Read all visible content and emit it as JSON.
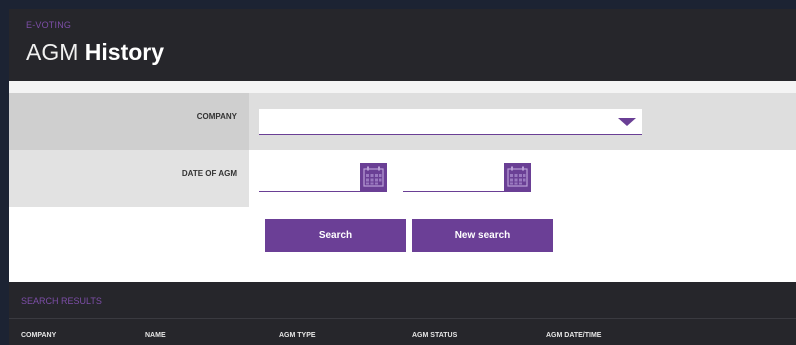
{
  "header": {
    "eyebrow": "E-VOTING",
    "title_light": "AGM",
    "title_bold": "History"
  },
  "form": {
    "company_label": "COMPANY",
    "company_value": "",
    "date_label": "DATE OF AGM",
    "date_from_value": "",
    "date_to_value": ""
  },
  "buttons": {
    "search_label": "Search",
    "new_search_label": "New search"
  },
  "results": {
    "title": "SEARCH RESULTS",
    "columns": [
      "COMPANY",
      "NAME",
      "AGM TYPE",
      "AGM STATUS",
      "AGM DATE/TIME"
    ]
  },
  "icons": {
    "select_arrow": "chevron-down-icon",
    "calendar": "calendar-icon"
  },
  "colors": {
    "accent": "#6b3f96",
    "header_bg": "#26262b"
  }
}
